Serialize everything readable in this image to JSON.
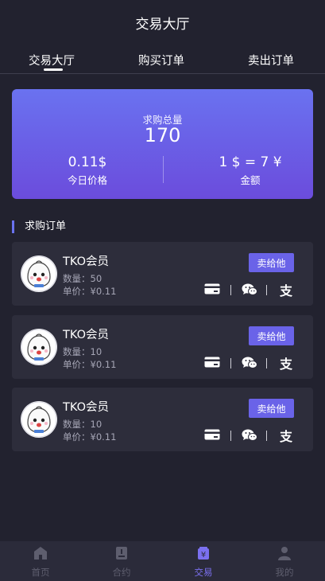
{
  "header": {
    "title": "交易大厅"
  },
  "tabs": [
    {
      "label": "交易大厅",
      "active": true
    },
    {
      "label": "购买订单",
      "active": false
    },
    {
      "label": "卖出订单",
      "active": false
    }
  ],
  "summary": {
    "total_label": "求购总量",
    "total_value": "170",
    "price_value": "0.11$",
    "price_label": "今日价格",
    "rate_value": "1 $ = 7 ¥",
    "rate_label": "金额"
  },
  "section": {
    "title": "求购订单"
  },
  "orders": [
    {
      "name": "TKO会员",
      "qty": "数量：50",
      "price": "单价：¥0.11",
      "button": "卖给他"
    },
    {
      "name": "TKO会员",
      "qty": "数量：10",
      "price": "单价：¥0.11",
      "button": "卖给他"
    },
    {
      "name": "TKO会员",
      "qty": "数量：10",
      "price": "单价：¥0.11",
      "button": "卖给他"
    }
  ],
  "payment_icons": [
    "bank-card-icon",
    "wechat-icon",
    "alipay-icon"
  ],
  "alipay_glyph": "支",
  "nav": [
    {
      "label": "首页",
      "icon": "home-icon",
      "active": false
    },
    {
      "label": "合约",
      "icon": "contract-icon",
      "active": false
    },
    {
      "label": "交易",
      "icon": "trade-icon",
      "active": true
    },
    {
      "label": "我的",
      "icon": "user-icon",
      "active": false
    }
  ],
  "colors": {
    "background": "#22222f",
    "card": "#2d2d3b",
    "accent": "#6a63e8",
    "hero_top": "#6a72f0",
    "hero_bottom": "#6b4cdc",
    "muted_text": "#a6a6b6",
    "nav_inactive": "#5e5e6e",
    "nav_active": "#7b70f0"
  }
}
